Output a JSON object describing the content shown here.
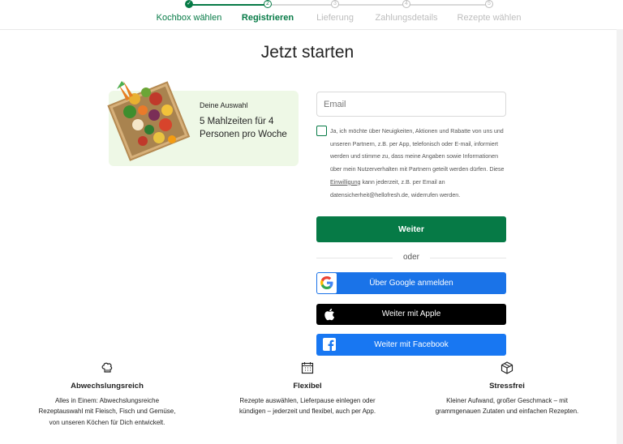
{
  "stepper": {
    "steps": [
      {
        "num": "✓",
        "label": "Kochbox wählen",
        "state": "done"
      },
      {
        "num": "2",
        "label": "Registrieren",
        "state": "active"
      },
      {
        "num": "3",
        "label": "Lieferung",
        "state": "todo"
      },
      {
        "num": "4",
        "label": "Zahlungsdetails",
        "state": "todo"
      },
      {
        "num": "5",
        "label": "Rezepte wählen",
        "state": "todo"
      }
    ]
  },
  "page": {
    "title": "Jetzt starten"
  },
  "selection": {
    "kicker": "Deine Auswahl",
    "text": "5 Mahlzeiten für 4 Personen pro Woche"
  },
  "form": {
    "email_placeholder": "Email",
    "consent_before": "Ja, ich möchte über Neuigkeiten, Aktionen und Rabatte von uns und unseren Partnern, z.B. per App, telefonisch oder E-mail, informiert werden und stimme zu, dass meine Angaben sowie Informationen über mein Nutzerverhalten mit Partnern geteilt werden dürfen. Diese ",
    "consent_link": "Einwilligung",
    "consent_after": " kann jederzeit, z.B. per Email an datensicherheit@hellofresh.de, widerrufen werden.",
    "submit_label": "Weiter",
    "divider_label": "oder",
    "google_label": "Über Google anmelden",
    "apple_label": "Weiter mit Apple",
    "facebook_label": "Weiter mit Facebook"
  },
  "features": [
    {
      "icon": "chef-hat-icon",
      "title": "Abwechslungsreich",
      "desc": "Alles in Einem: Abwechslungsreiche Rezeptauswahl mit Fleisch, Fisch und Gemüse, von unseren Köchen für Dich entwickelt."
    },
    {
      "icon": "calendar-icon",
      "title": "Flexibel",
      "desc": "Rezepte auswählen, Lieferpause einlegen oder kündigen – jederzeit und flexibel, auch per App."
    },
    {
      "icon": "box-icon",
      "title": "Stressfrei",
      "desc": "Kleiner Aufwand, großer Geschmack – mit grammgenauen Zutaten und einfachen Rezepten."
    }
  ],
  "colors": {
    "brand_green": "#067a46",
    "google_blue": "#1a73e8",
    "facebook_blue": "#1877f2",
    "apple_black": "#000000",
    "card_bg": "#eef8e6"
  }
}
